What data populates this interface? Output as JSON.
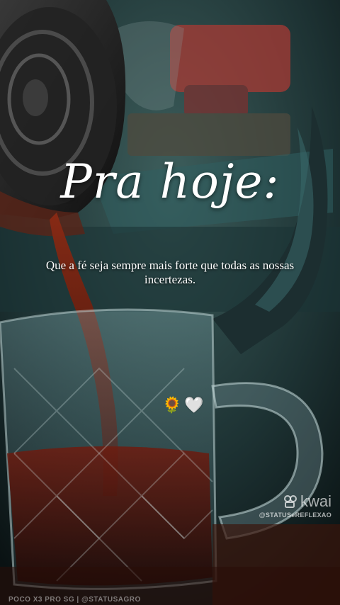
{
  "overlay": {
    "title": "Pra hoje:",
    "quote": "Que a fé seja sempre mais  forte que todas as nossas incertezas.",
    "emojis": {
      "sunflower": "🌻",
      "heart": "🤍"
    }
  },
  "watermark": {
    "brand": "kwai",
    "handle": "@STATUSeREFLEXAO",
    "icon": "kwai-camera-icon"
  },
  "footer": {
    "credit": "POCO X3 PRO SG | @STATUSAGRO"
  },
  "colors": {
    "text": "#ffffff",
    "background_dark": "#0e1a1c",
    "teal_tone": "#2e5a5e",
    "coffee_red": "#7a1a10"
  }
}
